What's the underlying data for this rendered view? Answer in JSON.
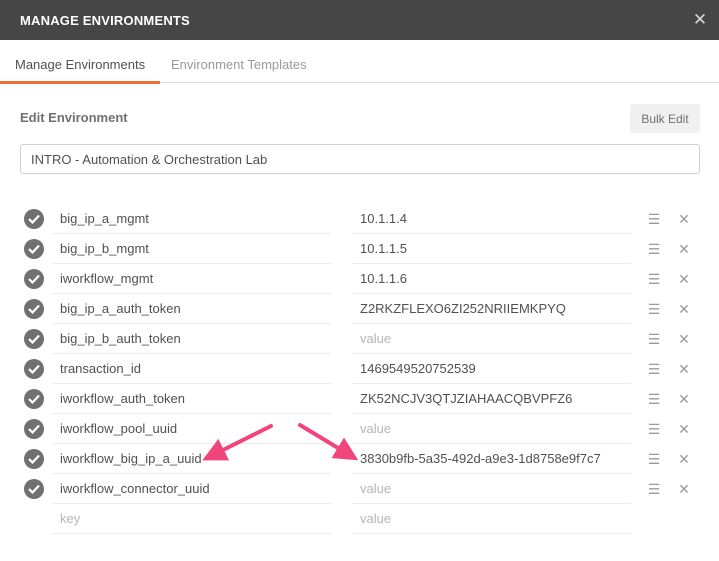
{
  "dialog": {
    "title": "MANAGE ENVIRONMENTS",
    "close_icon": "close-icon"
  },
  "tabs": [
    {
      "label": "Manage Environments",
      "active": true
    },
    {
      "label": "Environment Templates",
      "active": false
    }
  ],
  "edit": {
    "section_title": "Edit Environment",
    "bulk_edit_label": "Bulk Edit",
    "environment_name": "INTRO - Automation & Orchestration Lab"
  },
  "variables": [
    {
      "key": "big_ip_a_mgmt",
      "value": "10.1.1.4"
    },
    {
      "key": "big_ip_b_mgmt",
      "value": "10.1.1.5"
    },
    {
      "key": "iworkflow_mgmt",
      "value": "10.1.1.6"
    },
    {
      "key": "big_ip_a_auth_token",
      "value": "Z2RKZFLEXO6ZI252NRIIEMKPYQ"
    },
    {
      "key": "big_ip_b_auth_token",
      "value": ""
    },
    {
      "key": "transaction_id",
      "value": "1469549520752539"
    },
    {
      "key": "iworkflow_auth_token",
      "value": "ZK52NCJV3QTJZIAHAACQBVPFZ6"
    },
    {
      "key": "iworkflow_pool_uuid",
      "value": ""
    },
    {
      "key": "iworkflow_big_ip_a_uuid",
      "value": "3830b9fb-5a35-492d-a9e3-1d8758e9f7c7"
    },
    {
      "key": "iworkflow_connector_uuid",
      "value": ""
    }
  ],
  "placeholders": {
    "key": "key",
    "value": "value"
  },
  "colors": {
    "titlebar": "#464646",
    "accent": "#f26b3a",
    "arrow": "#f0457a"
  }
}
